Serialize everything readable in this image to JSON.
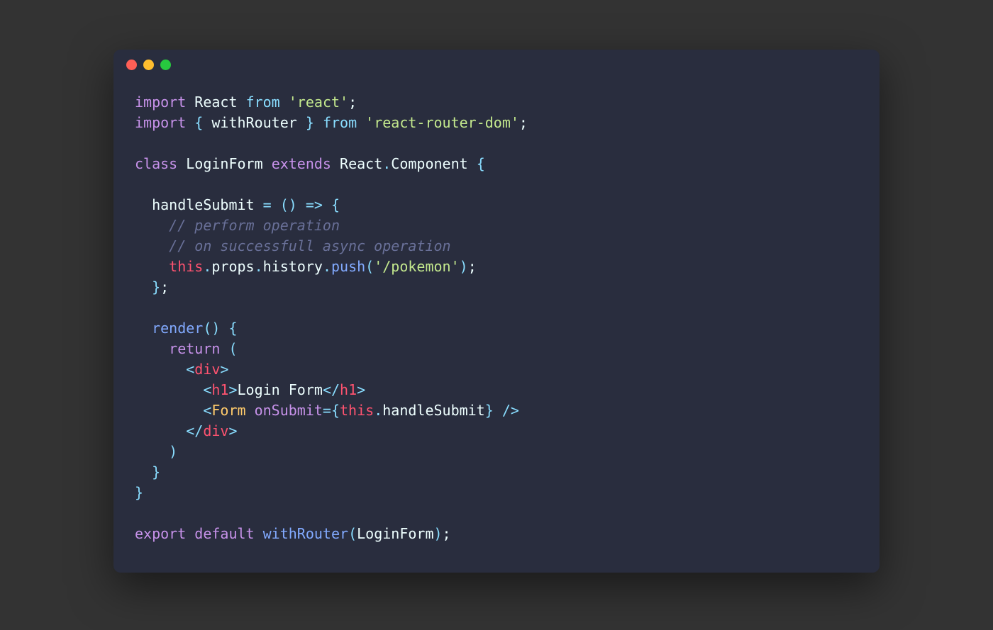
{
  "traffic_lights": {
    "close": "red",
    "minimize": "yellow",
    "zoom": "green"
  },
  "code": {
    "l1": {
      "import": "import",
      "react": "React",
      "from": "from",
      "lib": "'react'",
      "semi": ";"
    },
    "l2": {
      "import": "import",
      "lb": "{",
      "wr": "withRouter",
      "rb": "}",
      "from": "from",
      "lib": "'react-router-dom'",
      "semi": ";"
    },
    "l4": {
      "class": "class",
      "name": "LoginForm",
      "extends": "extends",
      "r": "React",
      "dot": ".",
      "comp": "Component",
      "lb": "{"
    },
    "l6": {
      "handle": "handleSubmit",
      "eq": "=",
      "lp": "(",
      "rp": ")",
      "arrow": "=>",
      "lb": "{"
    },
    "l7": {
      "c": "// perform operation"
    },
    "l8": {
      "c": "// on successfull async operation"
    },
    "l9": {
      "this": "this",
      "d1": ".",
      "props": "props",
      "d2": ".",
      "history": "history",
      "d3": ".",
      "push": "push",
      "lp": "(",
      "s": "'/pokemon'",
      "rp": ")",
      "semi": ";"
    },
    "l10": {
      "rb": "}",
      "semi": ";"
    },
    "l12": {
      "render": "render",
      "lp": "(",
      "rp": ")",
      "lb": "{"
    },
    "l13": {
      "ret": "return",
      "lp": "("
    },
    "l14": {
      "lt": "<",
      "div": "div",
      "gt": ">"
    },
    "l15": {
      "lt": "<",
      "h1": "h1",
      "gt": ">",
      "txt": "Login Form",
      "lt2": "</",
      "h12": "h1",
      "gt2": ">"
    },
    "l16": {
      "lt": "<",
      "form": "Form",
      "attr": "onSubmit",
      "eq": "=",
      "lb": "{",
      "this": "this",
      "d": ".",
      "hs": "handleSubmit",
      "rb": "}",
      "close": "/>"
    },
    "l17": {
      "lt": "</",
      "div": "div",
      "gt": ">"
    },
    "l18": {
      "rp": ")"
    },
    "l19": {
      "rb": "}"
    },
    "l20": {
      "rb": "}"
    },
    "l22": {
      "export": "export",
      "default": "default",
      "wr": "withRouter",
      "lp": "(",
      "lf": "LoginForm",
      "rp": ")",
      "semi": ";"
    }
  }
}
